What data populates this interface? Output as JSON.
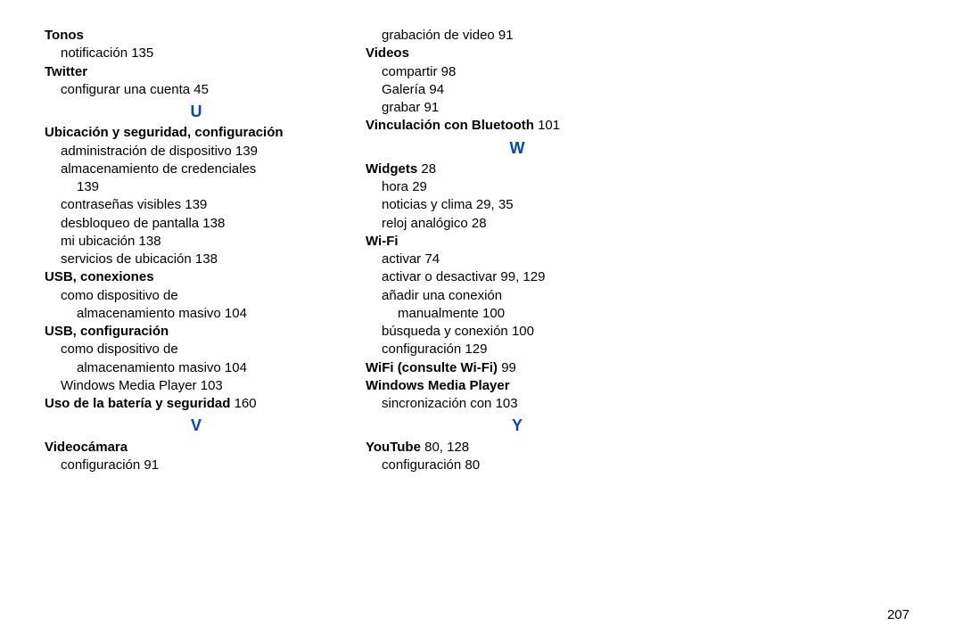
{
  "page_number": "207",
  "col1": {
    "tonos": {
      "title": "Tonos",
      "sub1": "notificación 135"
    },
    "twitter": {
      "title": "Twitter",
      "sub1": "configurar una cuenta 45"
    },
    "letter_u": "U",
    "ubicacion": {
      "title": "Ubicación y seguridad, configuración",
      "s1": "administración de dispositivo 139",
      "s2a": "almacenamiento de credenciales",
      "s2b": "139",
      "s3": "contraseñas visibles 139",
      "s4": "desbloqueo de pantalla 138",
      "s5": "mi ubicación 138",
      "s6": "servicios de ubicación 138"
    },
    "usb_conex": {
      "title": "USB, conexiones",
      "s1a": "como dispositivo de",
      "s1b": "almacenamiento masivo 104"
    },
    "usb_conf": {
      "title": "USB, configuración",
      "s1a": "como dispositivo de",
      "s1b": "almacenamiento masivo 104",
      "s2": "Windows Media Player 103"
    },
    "uso_bateria": {
      "title": "Uso de la batería y seguridad",
      "pages": " 160"
    },
    "letter_v": "V",
    "videocamara": {
      "title": "Videocámara",
      "s1": "configuración 91"
    }
  },
  "col2": {
    "grab_video": "grabación de video 91",
    "videos": {
      "title": "Videos",
      "s1": "compartir 98",
      "s2": "Galería 94",
      "s3": "grabar 91"
    },
    "vinc_bt": {
      "title": "Vinculación con Bluetooth",
      "pages": " 101"
    },
    "letter_w": "W",
    "widgets": {
      "title": "Widgets",
      "pages": " 28",
      "s1": "hora 29",
      "s2": "noticias y clima 29, 35",
      "s3": "reloj analógico 28"
    },
    "wifi": {
      "title": "Wi-Fi",
      "s1": "activar 74",
      "s2": "activar o desactivar 99, 129",
      "s3a": "añadir una conexión",
      "s3b": "manualmente 100",
      "s4": "búsqueda y conexión 100",
      "s5": "configuración 129"
    },
    "wifi_consulte": {
      "title": "WiFi (consulte Wi-Fi)",
      "pages": " 99"
    },
    "wmp": {
      "title": "Windows Media Player",
      "s1": "sincronización con 103"
    },
    "letter_y": "Y",
    "youtube": {
      "title": "YouTube",
      "pages": " 80, 128",
      "s1": "configuración 80"
    }
  }
}
